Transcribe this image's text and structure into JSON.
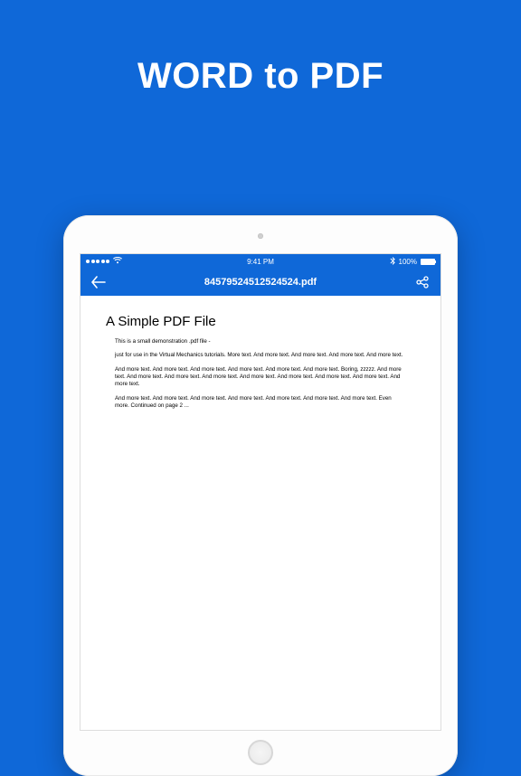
{
  "hero": {
    "title": "WORD to PDF"
  },
  "status": {
    "carrier": "",
    "time": "9:41 PM",
    "bt": "100%"
  },
  "nav": {
    "title": "84579524512524524.pdf"
  },
  "doc": {
    "title": "A Simple PDF File",
    "p1": "This is a small demonstration .pdf file -",
    "p2": "just for use in the Virtual Mechanics tutorials. More text. And more text. And more text. And more text. And more text.",
    "p3": "And more text. And more text. And more text. And more text. And more text. And more text. Boring, zzzzz. And more text. And more text. And more text. And more text. And more text. And more text. And more text. And more text. And more text.",
    "p4": "And more text. And more text. And more text. And more text. And more text. And more text. And more text. Even more. Continued on page 2 ..."
  }
}
